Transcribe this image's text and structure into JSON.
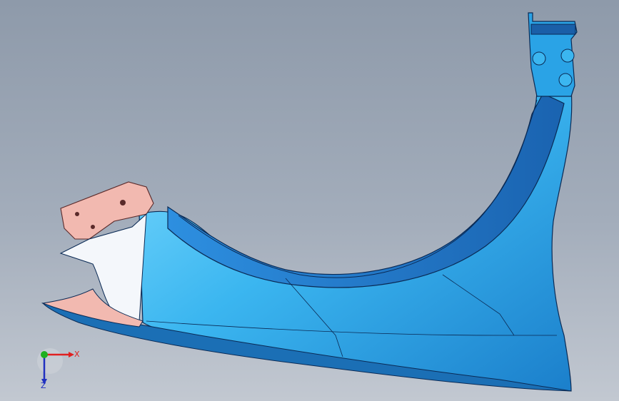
{
  "viewport": {
    "background_top": "#8e9aaa",
    "background_bottom": "#c2c8d1"
  },
  "model": {
    "part_color": "#2aa3e6",
    "part_highlight": "#7fdcff",
    "part_dark": "#1b6fb5",
    "bracket_color": "#f2b9b0",
    "edge_color": "#0a2a55"
  },
  "triad": {
    "x_label": "X",
    "z_label": "Z",
    "x_color": "#e02020",
    "y_color": "#20b020",
    "z_color": "#2030c0"
  }
}
